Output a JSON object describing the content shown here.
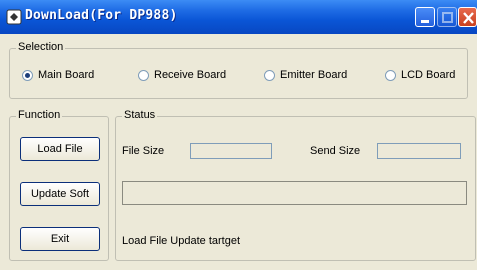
{
  "window": {
    "title": "DownLoad(For DP988)"
  },
  "selection": {
    "legend": "Selection",
    "options": [
      {
        "label": "Main Board",
        "checked": true
      },
      {
        "label": "Receive Board",
        "checked": false
      },
      {
        "label": "Emitter Board",
        "checked": false
      },
      {
        "label": "LCD Board",
        "checked": false
      }
    ]
  },
  "function": {
    "legend": "Function",
    "load_file": "Load File",
    "update_soft": "Update Soft",
    "exit": "Exit"
  },
  "status": {
    "legend": "Status",
    "file_size_label": "File Size",
    "file_size_value": "",
    "send_size_label": "Send Size",
    "send_size_value": "",
    "message": "Load File Update tartget"
  },
  "colors": {
    "titlebar": "#0a55d6",
    "dialog_bg": "#ece9d8",
    "close_button": "#c8401f"
  }
}
